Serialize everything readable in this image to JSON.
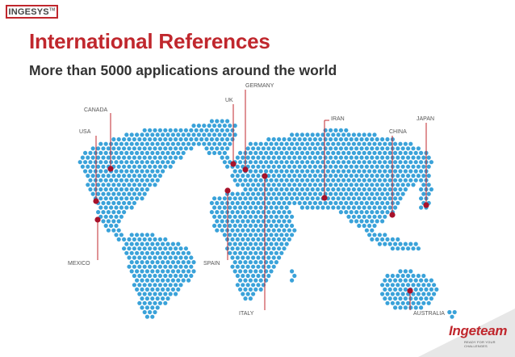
{
  "header": {
    "logo_text": "INGESYS",
    "logo_tm": "TM",
    "title": "International References",
    "subtitle": "More than 5000 applications around the world"
  },
  "map": {
    "dot_color": "#3aa2d9",
    "marker_color": "#a8122b",
    "line_color": "#c0272d",
    "label_color": "#555555",
    "references": [
      {
        "label": "CANADA"
      },
      {
        "label": "USA"
      },
      {
        "label": "MEXICO"
      },
      {
        "label": "UK"
      },
      {
        "label": "GERMANY"
      },
      {
        "label": "SPAIN"
      },
      {
        "label": "ITALY"
      },
      {
        "label": "IRAN"
      },
      {
        "label": "CHINA"
      },
      {
        "label": "JAPAN"
      },
      {
        "label": "AUSTRALIA"
      }
    ]
  },
  "footer": {
    "brand": "Ingeteam",
    "tagline": "READY FOR YOUR CHALLENGES"
  }
}
